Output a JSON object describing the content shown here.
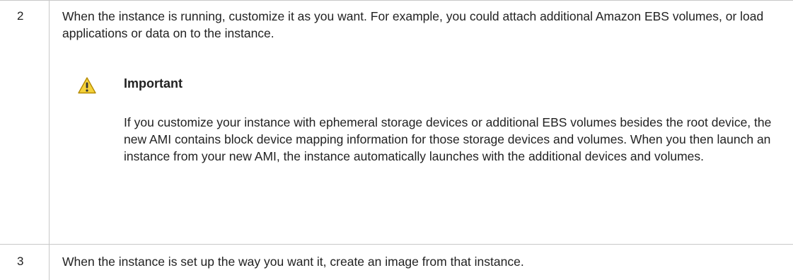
{
  "steps": [
    {
      "number": "2",
      "text": "When the instance is running, customize it as you want. For example, you could attach additional Amazon EBS volumes, or load applications or data on to the instance.",
      "callout": {
        "icon": "warning-icon",
        "title": "Important",
        "body": "If you customize your instance with ephemeral storage devices or additional EBS volumes besides the root device, the new AMI contains block device mapping information for those storage devices and volumes. When you then launch an instance from your new AMI, the instance automatically launches with the additional devices and volumes."
      }
    },
    {
      "number": "3",
      "text": "When the instance is set up the way you want it, create an image from that instance."
    }
  ],
  "colors": {
    "border": "#c8c8c8",
    "text": "#222222",
    "warning_fill": "#f5d23a",
    "warning_stroke": "#b58a00"
  }
}
